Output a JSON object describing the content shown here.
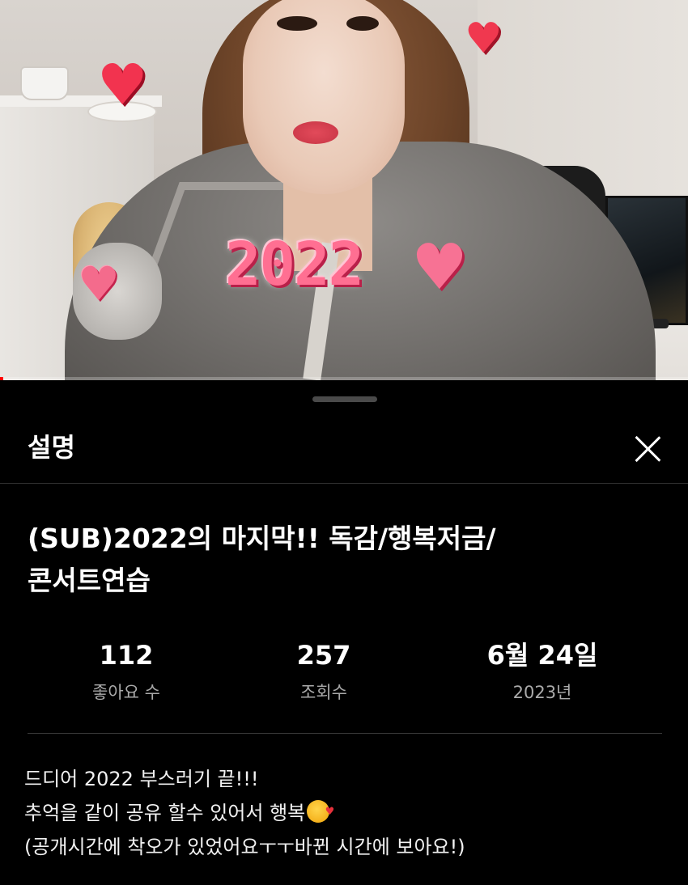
{
  "video": {
    "sticker_text": "2022",
    "progress": 0.005
  },
  "sheet": {
    "title": "설명",
    "close_icon": "close-icon"
  },
  "video_title": "(SUB)2022의 마지막!! 독감/행복저금/콘서트연습",
  "stats": [
    {
      "value": "112",
      "label": "좋아요 수"
    },
    {
      "value": "257",
      "label": "조회수"
    },
    {
      "value": "6월 24일",
      "label": "2023년"
    }
  ],
  "description": {
    "line1": "드디어 2022 부스러기 끝!!!",
    "line2": "추억을 같이 공유 할수 있어서 행복",
    "line2_emoji": "smiling-face-with-hearts-icon",
    "line3": "(공개시간에 착오가 있었어요ㅜㅜ바뀐 시간에 보아요!)"
  },
  "colors": {
    "background": "#000000",
    "progress": "#ff0000",
    "secondary_text": "#aaaaaa"
  }
}
